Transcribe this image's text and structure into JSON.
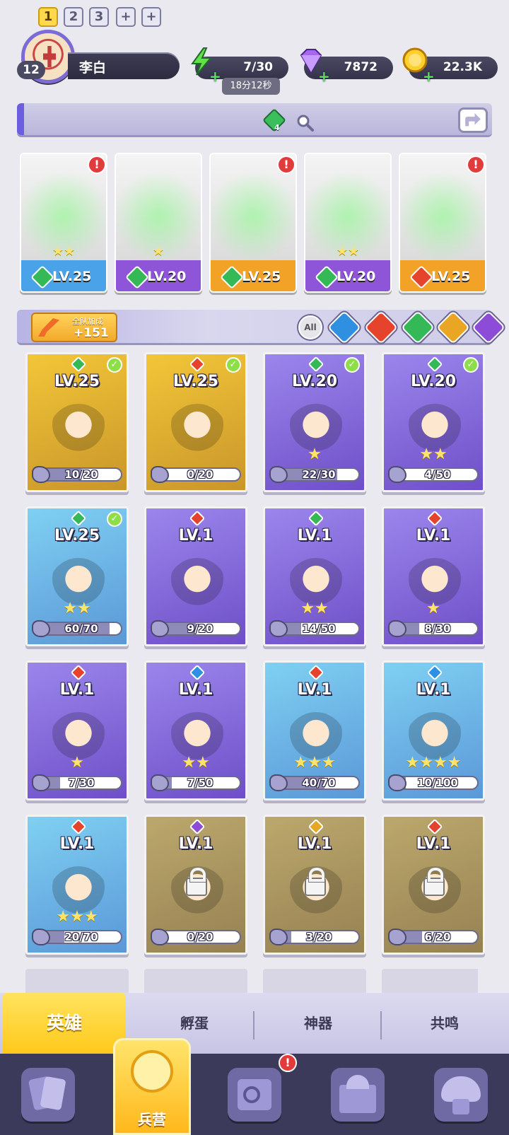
{
  "player": {
    "level": "12",
    "name": "李白"
  },
  "resources": {
    "energy": {
      "icon": "lightning-icon",
      "value": "7/30",
      "timer": "18分12秒"
    },
    "gems": {
      "icon": "diamond-icon",
      "value": "7872"
    },
    "gold": {
      "icon": "coin-icon",
      "value": "22.3K"
    }
  },
  "team_bar": {
    "slots": [
      "1",
      "2",
      "3",
      "+",
      "+"
    ],
    "active_slot": "1",
    "gem_count": "4"
  },
  "team": [
    {
      "level": "LV.25",
      "element": "wind",
      "stars": "★★",
      "alert": "!",
      "color": "#4aa3e8"
    },
    {
      "level": "LV.20",
      "element": "wind",
      "stars": "★",
      "alert": "",
      "color": "#8f55d8"
    },
    {
      "level": "LV.25",
      "element": "wind",
      "stars": "",
      "alert": "!",
      "color": "#f2a227"
    },
    {
      "level": "LV.20",
      "element": "wind",
      "stars": "★★",
      "alert": "",
      "color": "#8f55d8"
    },
    {
      "level": "LV.25",
      "element": "fire",
      "stars": "",
      "alert": "!",
      "color": "#f2a227"
    }
  ],
  "filter_bar": {
    "bonus_title": "全队加成",
    "bonus_value": "+151",
    "filters": [
      "All",
      "water",
      "fire",
      "wind",
      "light",
      "dark"
    ]
  },
  "elements": {
    "wind": "#35b956",
    "fire": "#e5432b",
    "water": "#2f8fe0",
    "light": "#e9a623",
    "dark": "#8c4cd8"
  },
  "heroes": [
    {
      "level": "LV.25",
      "element": "wind",
      "progress": "10/20",
      "pct": 0.5,
      "stars": "",
      "check": true,
      "locked": false,
      "rarity": "gold"
    },
    {
      "level": "LV.25",
      "element": "fire",
      "progress": "0/20",
      "pct": 0,
      "stars": "",
      "check": true,
      "locked": false,
      "rarity": "gold"
    },
    {
      "level": "LV.20",
      "element": "wind",
      "progress": "22/30",
      "pct": 0.73,
      "stars": "★",
      "check": true,
      "locked": false,
      "rarity": "purple"
    },
    {
      "level": "LV.20",
      "element": "wind",
      "progress": "4/50",
      "pct": 0.08,
      "stars": "★★",
      "check": true,
      "locked": false,
      "rarity": "purple"
    },
    {
      "level": "LV.25",
      "element": "wind",
      "progress": "60/70",
      "pct": 0.86,
      "stars": "★★",
      "check": true,
      "locked": false,
      "rarity": "blue"
    },
    {
      "level": "LV.1",
      "element": "fire",
      "progress": "9/20",
      "pct": 0.45,
      "stars": "",
      "check": false,
      "locked": false,
      "rarity": "purple"
    },
    {
      "level": "LV.1",
      "element": "wind",
      "progress": "14/50",
      "pct": 0.28,
      "stars": "★★",
      "check": false,
      "locked": false,
      "rarity": "purple"
    },
    {
      "level": "LV.1",
      "element": "fire",
      "progress": "8/30",
      "pct": 0.27,
      "stars": "★",
      "check": false,
      "locked": false,
      "rarity": "purple"
    },
    {
      "level": "LV.1",
      "element": "fire",
      "progress": "7/30",
      "pct": 0.23,
      "stars": "★",
      "check": false,
      "locked": false,
      "rarity": "purple"
    },
    {
      "level": "LV.1",
      "element": "water",
      "progress": "7/50",
      "pct": 0.14,
      "stars": "★★",
      "check": false,
      "locked": false,
      "rarity": "purple"
    },
    {
      "level": "LV.1",
      "element": "fire",
      "progress": "40/70",
      "pct": 0.57,
      "stars": "★★★",
      "check": false,
      "locked": false,
      "rarity": "blue"
    },
    {
      "level": "LV.1",
      "element": "water",
      "progress": "10/100",
      "pct": 0.1,
      "stars": "★★★★",
      "check": false,
      "locked": false,
      "rarity": "blue"
    },
    {
      "level": "LV.1",
      "element": "fire",
      "progress": "20/70",
      "pct": 0.29,
      "stars": "★★★",
      "check": false,
      "locked": false,
      "rarity": "blue"
    },
    {
      "level": "LV.1",
      "element": "dark",
      "progress": "0/20",
      "pct": 0,
      "stars": "",
      "check": false,
      "locked": true,
      "rarity": "gold"
    },
    {
      "level": "LV.1",
      "element": "light",
      "progress": "3/20",
      "pct": 0.15,
      "stars": "",
      "check": false,
      "locked": true,
      "rarity": "gold"
    },
    {
      "level": "LV.1",
      "element": "fire",
      "progress": "6/20",
      "pct": 0.3,
      "stars": "",
      "check": false,
      "locked": true,
      "rarity": "gold"
    }
  ],
  "rarity_colors": {
    "gold": [
      "#f3c638",
      "#c9962a"
    ],
    "purple": [
      "#9b86ec",
      "#6f4fc8"
    ],
    "blue": [
      "#7fd0f2",
      "#5a98d8"
    ]
  },
  "tabs": [
    "英雄",
    "孵蛋",
    "神器",
    "共鸣"
  ],
  "nav": {
    "active_label": "兵营",
    "alert": "!"
  }
}
